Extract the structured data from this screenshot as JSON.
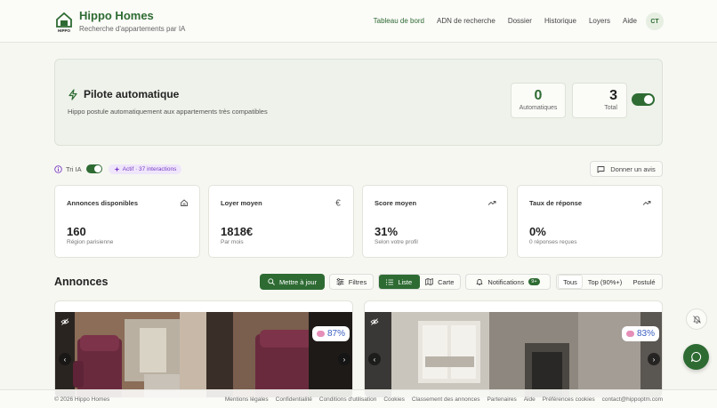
{
  "header": {
    "brand": "Hippo Homes",
    "tagline": "Recherche d'appartements par IA",
    "logo_text": "HIPPO",
    "nav": [
      {
        "label": "Tableau de bord",
        "active": true
      },
      {
        "label": "ADN de recherche",
        "active": false
      },
      {
        "label": "Dossier",
        "active": false
      },
      {
        "label": "Historique",
        "active": false
      },
      {
        "label": "Loyers",
        "active": false
      },
      {
        "label": "Aide",
        "active": false
      }
    ],
    "avatar_initials": "CT"
  },
  "autopilot": {
    "title": "Pilote automatique",
    "description": "Hippo postule automatiquement aux appartements très compatibles",
    "automatic_count": "0",
    "automatic_label": "Automatiques",
    "total_count": "3",
    "total_label": "Total",
    "enabled": true
  },
  "ai_sort": {
    "label": "Tri IA",
    "enabled": true,
    "badge": "Actif · 37 interactions"
  },
  "feedback_button": "Donner un avis",
  "kpis": [
    {
      "title": "Annonces disponibles",
      "value": "160",
      "sub": "Région parisienne",
      "icon": "home-icon"
    },
    {
      "title": "Loyer moyen",
      "value": "1818€",
      "sub": "Par mois",
      "icon": "euro-icon"
    },
    {
      "title": "Score moyen",
      "value": "31%",
      "sub": "Selon votre profil",
      "icon": "trend-up-icon"
    },
    {
      "title": "Taux de réponse",
      "value": "0%",
      "sub": "0 réponses reçues",
      "icon": "trend-up-icon"
    }
  ],
  "listings_section": {
    "title": "Annonces",
    "update_button": "Mettre à jour",
    "filters_button": "Filtres",
    "view_options": [
      {
        "label": "Liste",
        "active": true
      },
      {
        "label": "Carte",
        "active": false
      }
    ],
    "notifications_label": "Notifications",
    "notifications_badge": "9+",
    "filter_tabs": [
      {
        "label": "Tous",
        "active": true
      },
      {
        "label": "Top (90%+)",
        "active": false
      },
      {
        "label": "Postulé",
        "active": false
      }
    ]
  },
  "listings": [
    {
      "score": "87%"
    },
    {
      "score": "83%"
    }
  ],
  "footer": {
    "copyright": "© 2026 Hippo Homes",
    "links": [
      "Mentions légales",
      "Confidentialité",
      "Conditions d'utilisation",
      "Cookies",
      "Classement des annonces",
      "Partenaires",
      "Aide",
      "Préférences cookies",
      "contact@hippoptm.com"
    ]
  },
  "colors": {
    "brand_green": "#2e6b33",
    "background": "#f7f7f2",
    "ai_purple": "#7a3dc4",
    "score_blue": "#3a5fc2"
  }
}
